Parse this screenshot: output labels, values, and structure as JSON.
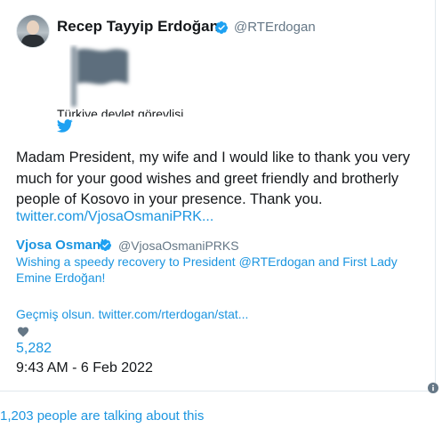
{
  "author": {
    "name": "Recep Tayyip Erdoğan",
    "handle": "@RTErdogan",
    "avatar_icon": "avatar-photo"
  },
  "embedded_media": {
    "caption": "Türkiye devlet görevlisi",
    "icon": "flag-placeholder-icon"
  },
  "source_icon": "twitter-bird-icon",
  "tweet": {
    "text": "Madam President, my wife and I would like to thank you very much for your good wishes and greet friendly and brotherly people of Kosovo in your presence. Thank you.",
    "link": "twitter.com/VjosaOsmaniPRK..."
  },
  "quoted": {
    "name": "Vjosa Osmani",
    "handle": "@VjosaOsmaniPRKS",
    "text": "Wishing a speedy recovery to President @RTErdogan and First Lady Emine Erdoğan!",
    "link": "Geçmiş olsun. twitter.com/rterdogan/stat..."
  },
  "stats": {
    "likes": "5,282",
    "timestamp": "9:43 AM - 6 Feb 2022"
  },
  "footer": {
    "talking": "1,203 people are talking about this"
  },
  "colors": {
    "link": "#1b95e0",
    "verified": "#1da1f2",
    "text": "#14171a",
    "muted": "#657786"
  }
}
